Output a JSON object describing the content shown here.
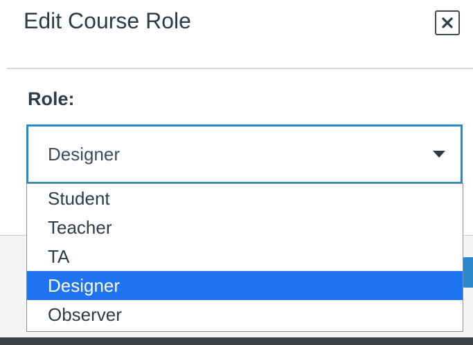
{
  "dialog": {
    "title": "Edit Course Role",
    "close_icon": "close-icon",
    "close_glyph": "×"
  },
  "form": {
    "role_label": "Role:",
    "selected_value": "Designer",
    "caret_icon": "chevron-down-icon"
  },
  "dropdown": {
    "options": [
      {
        "label": "Student",
        "selected": false
      },
      {
        "label": "Teacher",
        "selected": false
      },
      {
        "label": "TA",
        "selected": false
      },
      {
        "label": "Designer",
        "selected": true
      },
      {
        "label": "Observer",
        "selected": false
      }
    ]
  },
  "colors": {
    "accent": "#2a88cf",
    "selected_option_bg": "#1e74f0",
    "text": "#2d3b45"
  }
}
